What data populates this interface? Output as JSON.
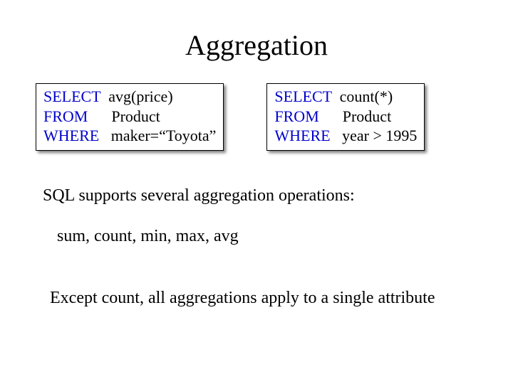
{
  "title": "Aggregation",
  "queries": {
    "left": {
      "l1_kw": "SELECT",
      "l1_rest": "avg(price)",
      "l2_kw": "FROM",
      "l2_rest": "Product",
      "l3_kw": "WHERE",
      "l3_rest": "maker=“Toyota”"
    },
    "right": {
      "l1_kw": "SELECT",
      "l1_rest": "count(*)",
      "l2_kw": "FROM",
      "l2_rest": "Product",
      "l3_kw": "WHERE",
      "l3_rest": "year > 1995"
    }
  },
  "body": {
    "intro": "SQL supports several aggregation operations:",
    "ops": "sum, count, min, max, avg",
    "note": "Except count, all aggregations apply to a single attribute"
  }
}
